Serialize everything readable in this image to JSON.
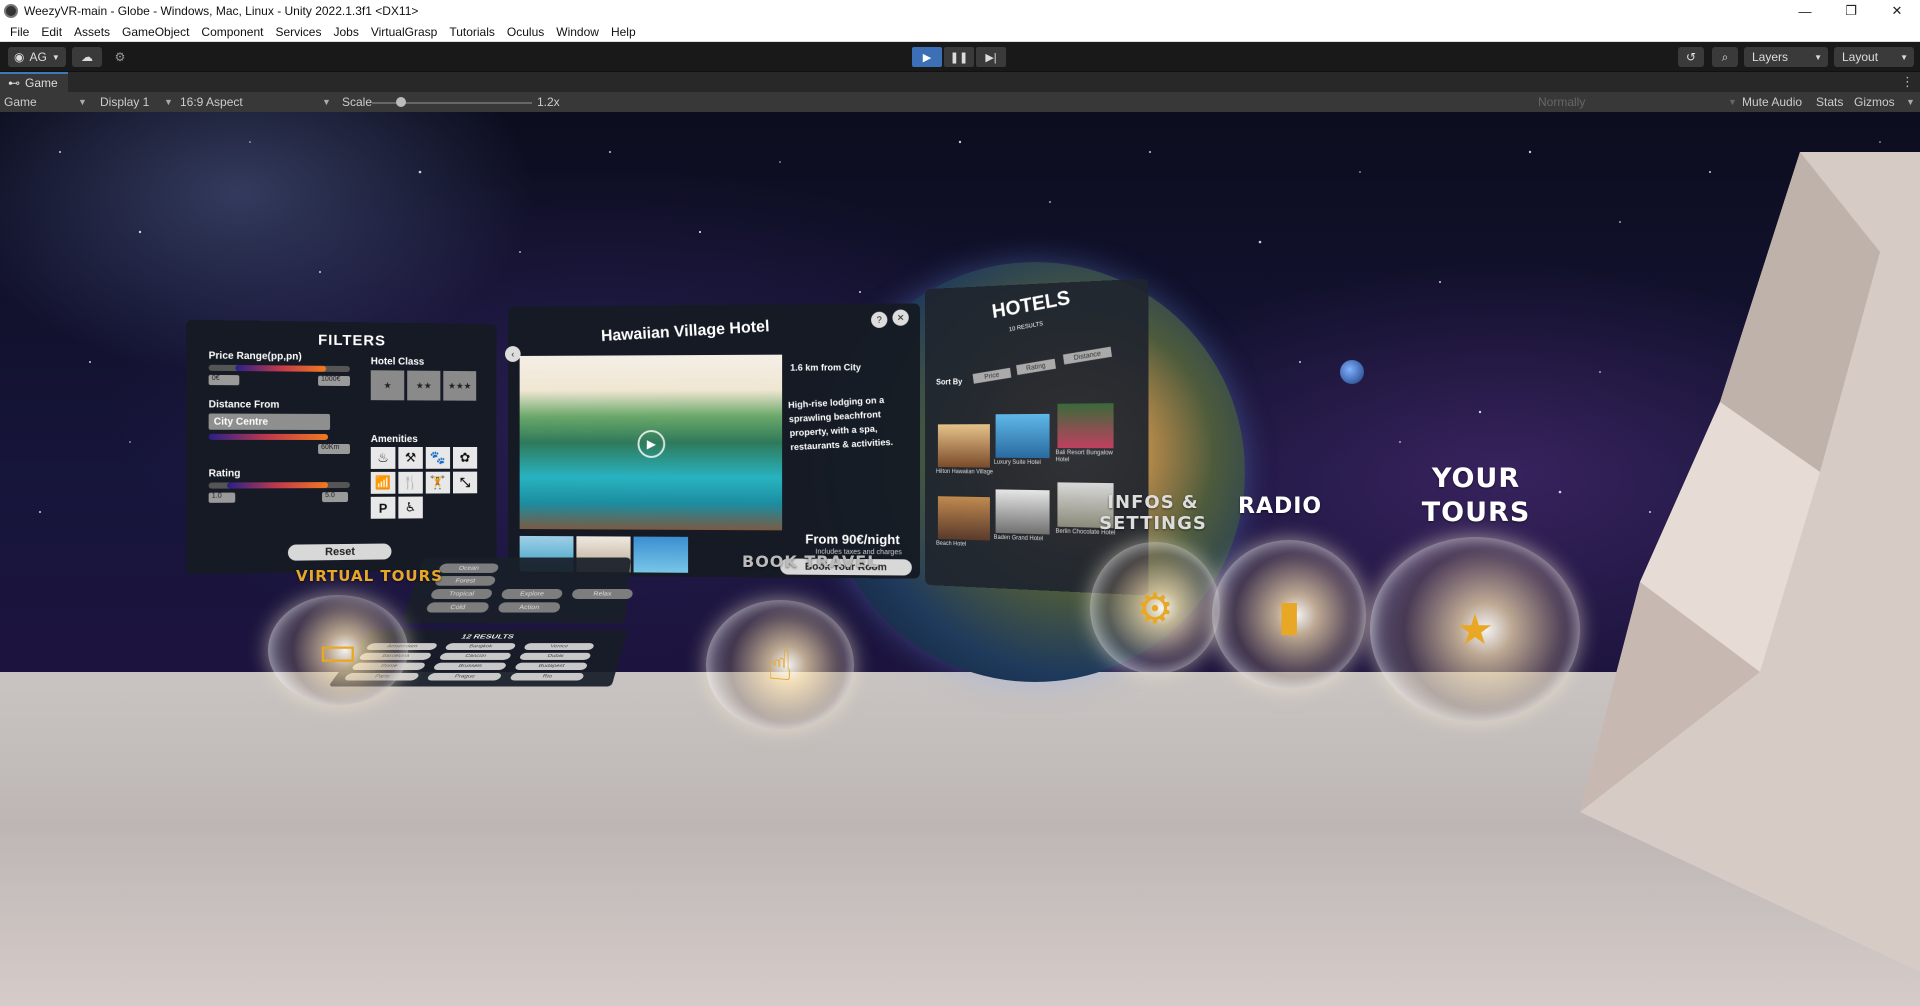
{
  "window": {
    "title": "WeezyVR-main - Globe - Windows, Mac, Linux - Unity 2022.1.3f1 <DX11>",
    "minimize": "—",
    "maximize": "❐",
    "close": "✕"
  },
  "menu": [
    "File",
    "Edit",
    "Assets",
    "GameObject",
    "Component",
    "Services",
    "Jobs",
    "VirtualGrasp",
    "Tutorials",
    "Oculus",
    "Window",
    "Help"
  ],
  "toolbar": {
    "account_label": "AG",
    "layers_label": "Layers",
    "layout_label": "Layout",
    "play_state": "playing"
  },
  "game_tab": {
    "tab_label": "Game",
    "mode": "Game",
    "display": "Display 1",
    "aspect": "16:9 Aspect",
    "scale_label": "Scale",
    "scale_value": "1.2x",
    "lighting": "Normally",
    "mute_audio": "Mute Audio",
    "stats": "Stats",
    "gizmos": "Gizmos"
  },
  "filters": {
    "title": "FILTERS",
    "price_label": "Price Range(pp,pn)",
    "price_min": "0€",
    "price_max": "1000€",
    "hotel_class_label": "Hotel Class",
    "distance_label": "Distance From",
    "distance_value": "City Centre",
    "distance_max": "60Km",
    "amenities_label": "Amenities",
    "amenities": [
      "♨",
      "⚒",
      "🐾",
      "✿",
      "📶",
      "🍴",
      "🏋",
      "⤡",
      "P",
      "♿"
    ],
    "rating_label": "Rating",
    "rating_min": "1.0",
    "rating_max": "5.0",
    "reset_label": "Reset"
  },
  "hotel": {
    "title": "Hawaiian Village Hotel",
    "distance": "1.6 km from City",
    "description": "High-rise lodging on a sprawling beachfront property, with a spa, restaurants & activities.",
    "price": "From 90€/night",
    "tax_note": "Includes taxes and charges",
    "book_label": "Book Your Room"
  },
  "hotels_panel": {
    "title": "HOTELS",
    "count": "10 RESULTS",
    "sort_label": "Sort By",
    "sort_options": [
      "Price",
      "Rating",
      "Distance"
    ],
    "cards": [
      "Hilton Hawaiian Village",
      "Luxury Suite Hotel",
      "Bali Resort Bungalow Hotel",
      "Beach Hotel",
      "Baden Grand Hotel",
      "Berlin Chocolate Hotel"
    ]
  },
  "tours": {
    "heading": "VIRTUAL TOURS",
    "results_title": "12 RESULTS",
    "categories": [
      "Ocean",
      "Forest",
      "Tropical",
      "Explore",
      "Relax",
      "Cold",
      "Action"
    ],
    "results": [
      "Amsterdam",
      "Bangkok",
      "Venice",
      "Barcelona",
      "Cancún",
      "Dubai",
      "Rome",
      "Brussels",
      "Budapest",
      "Paris",
      "Prague",
      "Rio"
    ]
  },
  "vr_buttons": {
    "virtual_tours": "VIRTUAL TOURS",
    "book_travel": "BOOK TRAVEL",
    "infos_settings": "INFOS & SETTINGS",
    "radio": "RADIO",
    "your_tours": "YOUR TOURS"
  },
  "colors": {
    "unity_play_active": "#3b6fb6",
    "accent_orange": "#e8a825",
    "panel_bg": "#141a22"
  }
}
